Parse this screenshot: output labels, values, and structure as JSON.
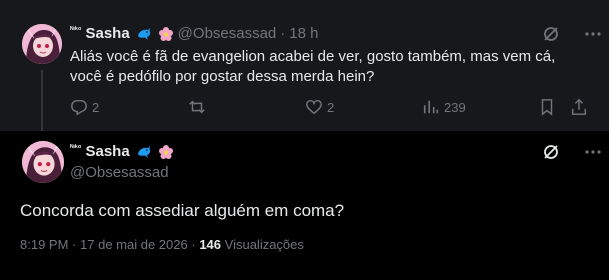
{
  "reply_tweet": {
    "display_name": "Sasha",
    "name_prefix": "ᴺᶦᵏᵒ",
    "handle": "@Obsesassad",
    "separator": "·",
    "time": "18 h",
    "text": "Aliás você é fã de evangelion acabei de ver, gosto também, mas vem cá, você é pedófilo por gostar dessa merda hein?",
    "replies": "2",
    "retweets": "",
    "likes": "2",
    "views": "239",
    "icons": [
      "grok-icon",
      "more-icon",
      "reply-icon",
      "retweet-icon",
      "like-icon",
      "views-icon",
      "bookmark-icon",
      "share-icon"
    ]
  },
  "main_tweet": {
    "display_name": "Sasha",
    "name_prefix": "ᴺᶦᵏᵒ",
    "handle": "@Obsesassad",
    "text": "Concorda com assediar alguém em coma?",
    "time": "8:19 PM",
    "date": "17 de mai de 2026",
    "separator": "·",
    "views_count": "146",
    "views_label": "Visualizações"
  },
  "colors": {
    "background": "#000000",
    "reply_background": "#16181c",
    "text": "#e7e9ea",
    "muted": "#71767b",
    "dolphin": "#1d9bf0",
    "flower": "#f4a6c7"
  }
}
